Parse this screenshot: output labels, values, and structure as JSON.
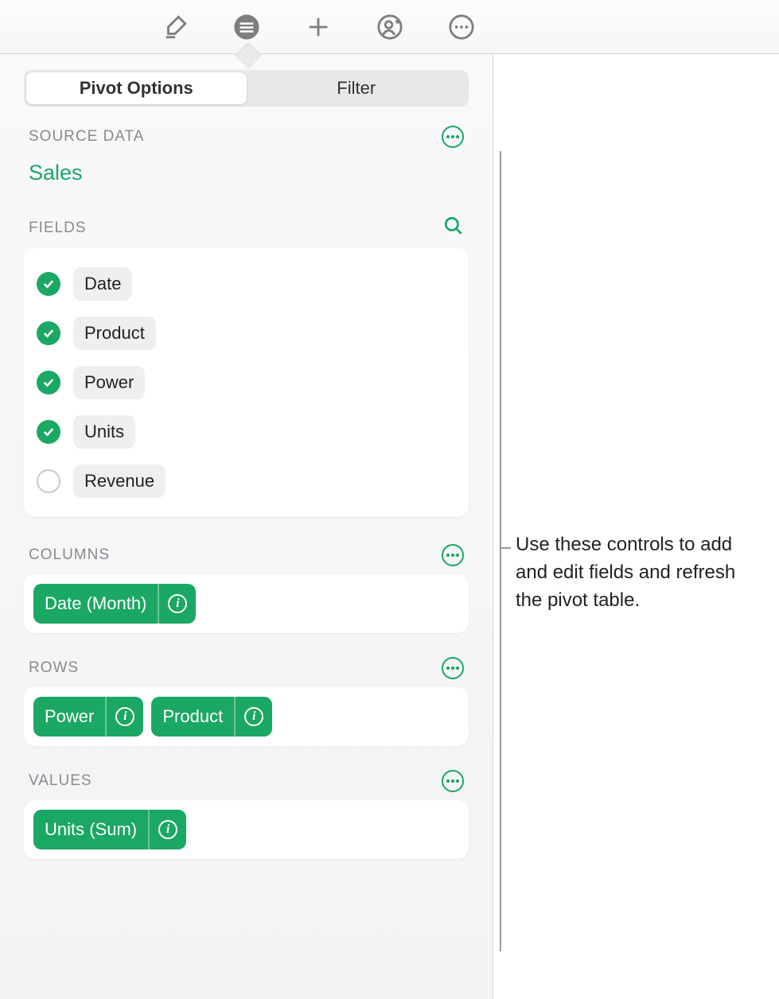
{
  "tabs": {
    "pivot_options": "Pivot Options",
    "filter": "Filter"
  },
  "sections": {
    "source_data": "SOURCE DATA",
    "fields": "FIELDS",
    "columns": "COLUMNS",
    "rows": "ROWS",
    "values": "VALUES"
  },
  "source": {
    "name": "Sales"
  },
  "fields": [
    {
      "label": "Date",
      "checked": true
    },
    {
      "label": "Product",
      "checked": true
    },
    {
      "label": "Power",
      "checked": true
    },
    {
      "label": "Units",
      "checked": true
    },
    {
      "label": "Revenue",
      "checked": false
    }
  ],
  "columns": [
    {
      "label": "Date (Month)"
    }
  ],
  "rows": [
    {
      "label": "Power"
    },
    {
      "label": "Product"
    }
  ],
  "values": [
    {
      "label": "Units (Sum)"
    }
  ],
  "callout": "Use these controls to add and edit fields and refresh the pivot table."
}
